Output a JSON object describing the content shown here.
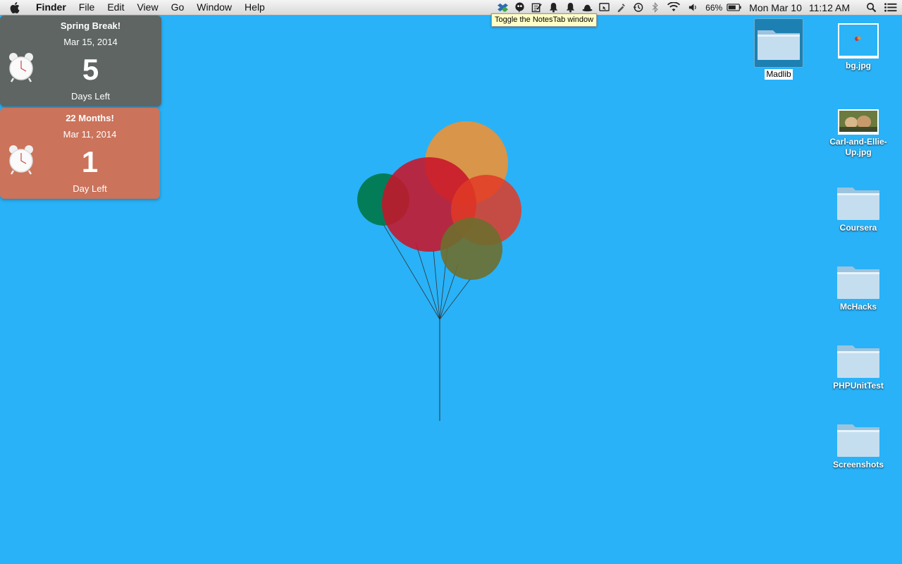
{
  "menubar": {
    "app_name": "Finder",
    "menus": [
      "File",
      "Edit",
      "View",
      "Go",
      "Window",
      "Help"
    ],
    "battery_percent": "66%",
    "date": "Mon Mar 10",
    "time": "11:12 AM",
    "tray_icons": [
      "dropbox-icon",
      "evernote-icon",
      "notestab-icon",
      "bell-icon",
      "bell-icon",
      "bowler-hat-icon",
      "screen-share-icon",
      "clipboard-icon",
      "time-machine-icon",
      "bluetooth-icon",
      "wifi-icon",
      "volume-icon",
      "battery-icon",
      "spotlight-icon",
      "notification-center-icon"
    ]
  },
  "tooltip": "Toggle the NotesTab window",
  "widgets": [
    {
      "title": "Spring Break!",
      "date": "Mar 15, 2014",
      "count": "5",
      "label": "Days Left",
      "color": "#5e6563"
    },
    {
      "title": "22 Months!",
      "date": "Mar 11, 2014",
      "count": "1",
      "label": "Day Left",
      "color": "#cb735b"
    }
  ],
  "desktop": {
    "background_color": "#29b2f7",
    "icons": [
      {
        "label": "Madlib",
        "type": "folder",
        "selected": true
      },
      {
        "label": "bg.jpg",
        "type": "image"
      },
      {
        "label": "Carl-and-Ellie-Up.jpg",
        "type": "image"
      },
      {
        "label": "Coursera",
        "type": "folder"
      },
      {
        "label": "McHacks",
        "type": "folder"
      },
      {
        "label": "PHPUnitTest",
        "type": "folder"
      },
      {
        "label": "Screenshots",
        "type": "folder"
      }
    ]
  },
  "balloon_colors": [
    "#e8923a",
    "#007a4f",
    "#c8142a",
    "#e03a26",
    "#6d6e2e"
  ]
}
